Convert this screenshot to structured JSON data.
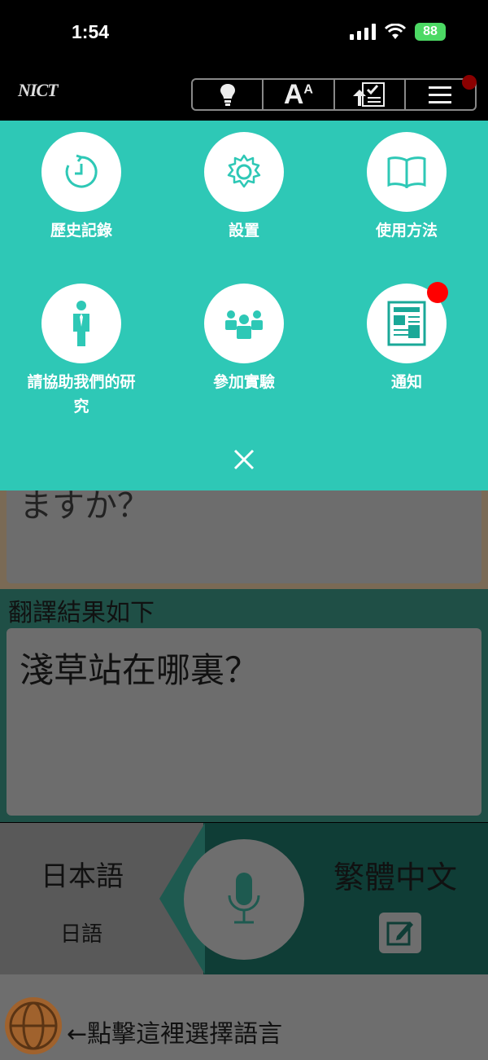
{
  "status": {
    "time": "1:54",
    "battery": "88"
  },
  "header": {
    "logo": "NICT"
  },
  "toolbar": {
    "items": [
      {
        "icon": "lightbulb-icon"
      },
      {
        "icon": "font-size-icon",
        "label": "A",
        "sup": "A"
      },
      {
        "icon": "upload-checklist-icon"
      },
      {
        "icon": "hamburger-menu-icon"
      }
    ]
  },
  "menu": {
    "items": [
      {
        "label": "歷史記錄",
        "icon": "history-icon"
      },
      {
        "label": "設置",
        "icon": "gear-icon"
      },
      {
        "label": "使用方法",
        "icon": "book-icon"
      },
      {
        "label": "請協助我們的研究",
        "icon": "person-icon"
      },
      {
        "label": "參加實驗",
        "icon": "group-icon"
      },
      {
        "label": "通知",
        "icon": "newspaper-icon"
      }
    ],
    "close_icon": "close-icon"
  },
  "input": {
    "text": "ますか？"
  },
  "result": {
    "label": "翻譯結果如下",
    "text": "淺草站在哪裏？"
  },
  "languages": {
    "from": "日本語",
    "from_sub": "日語",
    "to": "繁體中文"
  },
  "bottom": {
    "hint": "←點擊這裡選擇語言"
  },
  "colors": {
    "menu_bg": "#2ec8b6",
    "badge": "#ff0000",
    "battery": "#4cd964"
  }
}
